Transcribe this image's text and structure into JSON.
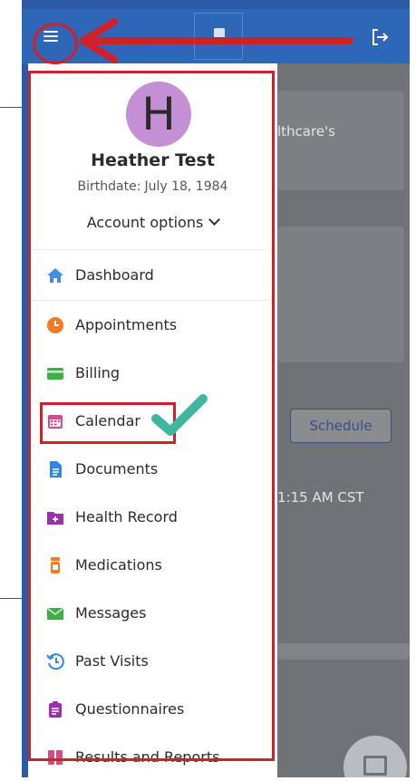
{
  "topbar": {
    "menu_icon": "hamburger-menu-icon",
    "calendar_icon": "calendar-icon",
    "logout_icon": "logout-icon"
  },
  "background": {
    "snippet_healthcare": "lthcare's",
    "schedule_label": "Schedule",
    "time_snippet": "1:15 AM CST"
  },
  "profile": {
    "initial": "H",
    "name": "Heather Test",
    "birthdate_label": "Birthdate:",
    "birthdate": "July 18, 1984",
    "account_options": "Account options"
  },
  "nav": {
    "items": [
      {
        "label": "Dashboard",
        "icon": "home-icon",
        "color": "#3f8fe8"
      },
      {
        "label": "Appointments",
        "icon": "clock-icon",
        "color": "#f07a26"
      },
      {
        "label": "Billing",
        "icon": "wallet-icon",
        "color": "#3fae49"
      },
      {
        "label": "Calendar",
        "icon": "calendar-icon",
        "color": "#d64a86"
      },
      {
        "label": "Documents",
        "icon": "document-icon",
        "color": "#2f86e6"
      },
      {
        "label": "Health Record",
        "icon": "health-folder-icon",
        "color": "#9c2fb0"
      },
      {
        "label": "Medications",
        "icon": "pill-bottle-icon",
        "color": "#f07a26"
      },
      {
        "label": "Messages",
        "icon": "envelope-icon",
        "color": "#3fae49"
      },
      {
        "label": "Past Visits",
        "icon": "history-icon",
        "color": "#2f86e6"
      },
      {
        "label": "Questionnaires",
        "icon": "clipboard-icon",
        "color": "#9c2fb0"
      },
      {
        "label": "Results and Reports",
        "icon": "results-icon",
        "color": "#d64a86"
      }
    ]
  },
  "colors": {
    "topbar": "#2f67b8",
    "annotation": "#d0202a",
    "check": "#3fb6a0",
    "avatar": "#c48fd5"
  }
}
